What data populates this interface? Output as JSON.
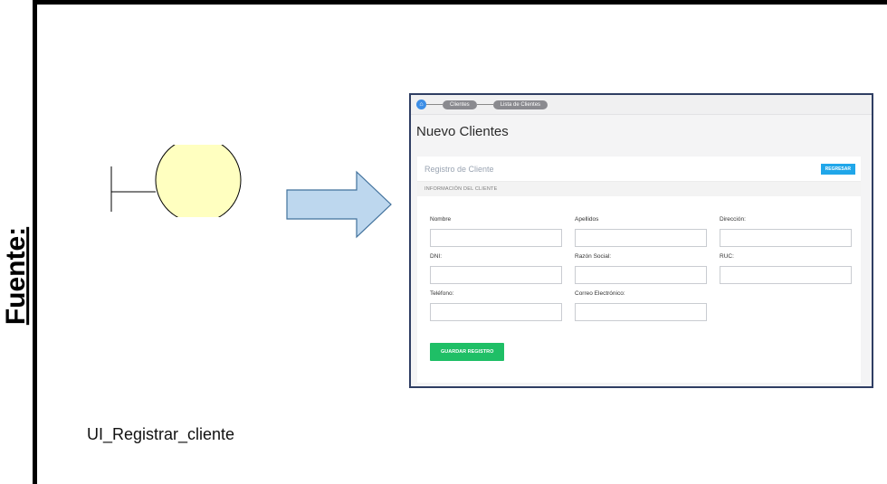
{
  "side_label": "Fuente:",
  "caption": "UI_Registrar_cliente",
  "colors": {
    "boundary_fill": "#ffffc0",
    "arrow_fill": "#bdd7ee",
    "arrow_stroke": "#41719c"
  },
  "screenshot": {
    "breadcrumb": {
      "home_icon": "home-icon",
      "items": [
        "Clientes",
        "Lista de Clientes"
      ]
    },
    "page_title": "Nuevo Clientes",
    "panel_title": "Registro de Cliente",
    "back_button": "REGRESAR",
    "section_title": "INFORMACIÓN DEL CLIENTE",
    "fields": [
      [
        "Nombre",
        "Apellidos",
        "Dirección:"
      ],
      [
        "DNI:",
        "Razón Social:",
        "RUC:"
      ],
      [
        "Teléfono:",
        "Correo Electrónico:"
      ]
    ],
    "save_button": "GUARDAR REGISTRO"
  }
}
